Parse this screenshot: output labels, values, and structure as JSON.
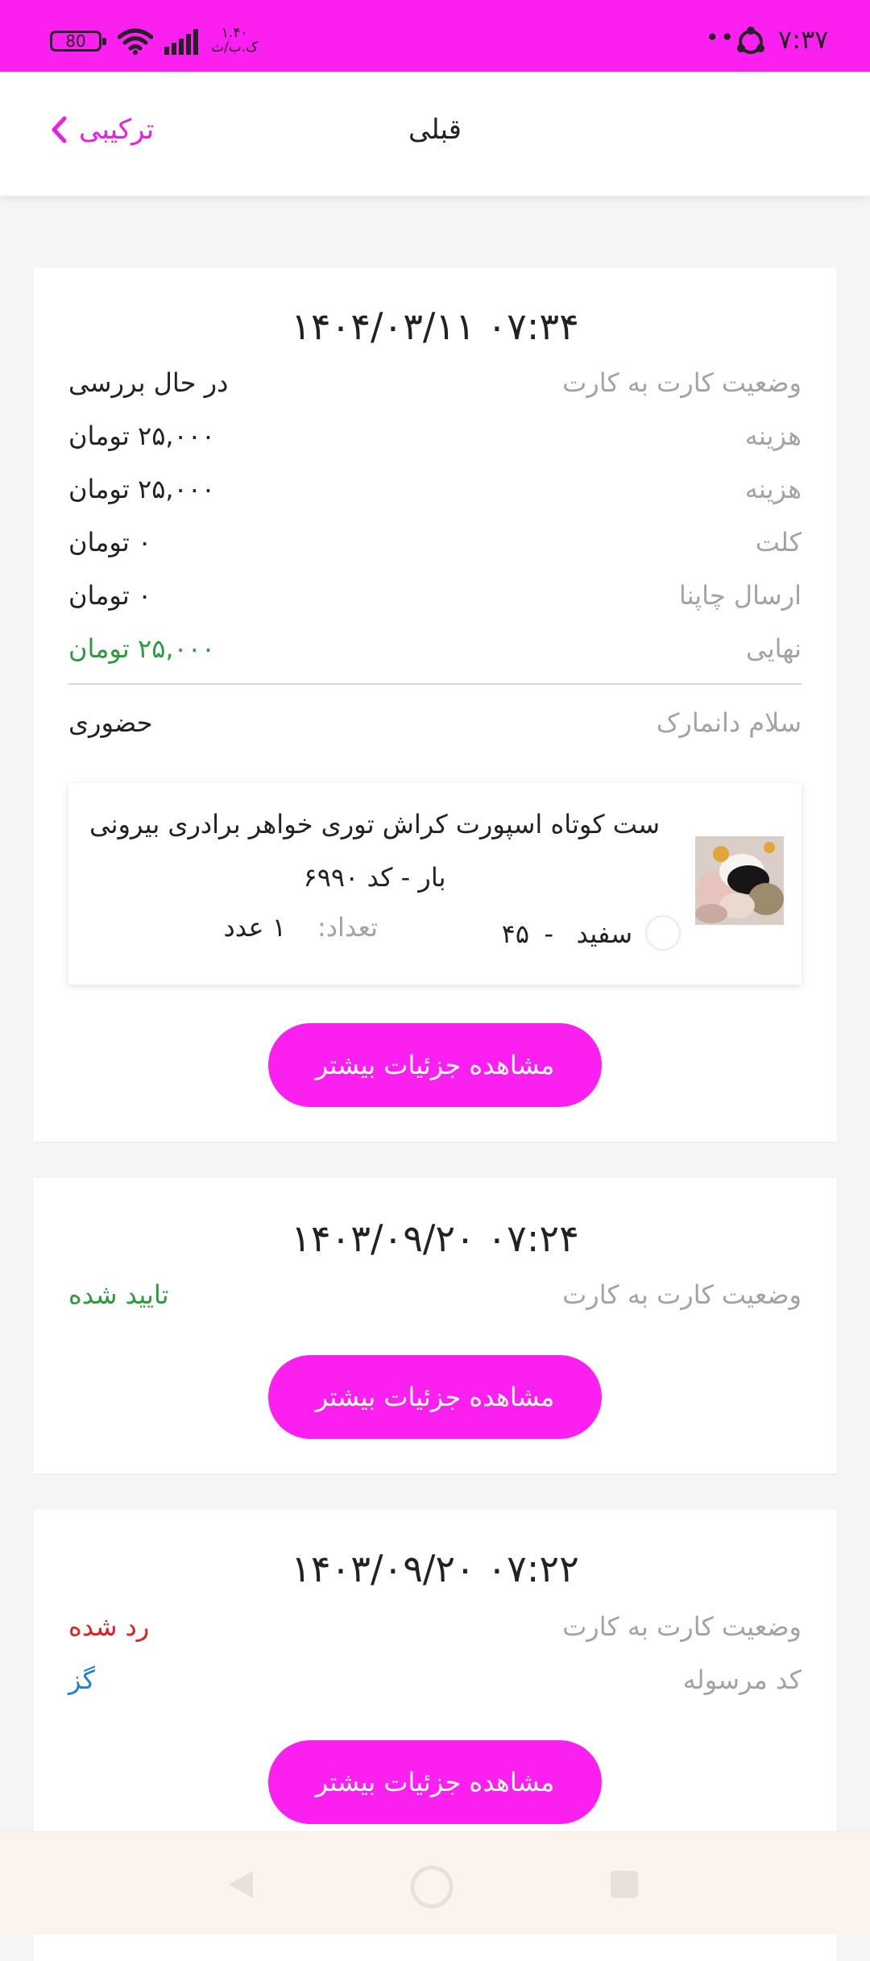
{
  "status_bar": {
    "time": "۷:۳۷",
    "dots": "••",
    "battery": "80",
    "speed_value": "۱.۴۰",
    "speed_unit": "ک.ب/ث"
  },
  "header": {
    "title": "قبلی",
    "back_label": "ترکیبی"
  },
  "cards": [
    {
      "date": "۱۴۰۴/۰۳/۱۱  ۰۷:۳۴",
      "rows": [
        {
          "label": "وضعیت کارت به کارت",
          "value": "در حال بررسی"
        },
        {
          "label": "هزینه",
          "value": "۲۵,۰۰۰ تومان"
        },
        {
          "label": "هزینه",
          "value": "۲۵,۰۰۰ تومان"
        },
        {
          "label": "کلت",
          "value": "۰ تومان"
        },
        {
          "label": "ارسال چاپنا",
          "value": "۰ تومان"
        },
        {
          "label": "نهایی",
          "value": "۲۵,۰۰۰ تومان"
        }
      ],
      "delivery": {
        "label": "سلام دانمارک",
        "value": "حضوری"
      },
      "item": {
        "title": "ست کوتاه اسپورت کراش توری خواهر برادری بیرونی بار - کد ۶۹۹۰",
        "color": "سفید",
        "size": "۴۵",
        "dash": "-",
        "qty_label": "تعداد:",
        "qty_value": "۱ عدد"
      },
      "button": "مشاهده جزئیات بیشتر"
    },
    {
      "date": "۱۴۰۳/۰۹/۲۰  ۰۷:۲۴",
      "rows": [
        {
          "label": "وضعیت کارت به کارت",
          "value": "تایید شده"
        }
      ],
      "button": "مشاهده جزئیات بیشتر"
    },
    {
      "date": "۱۴۰۳/۰۹/۲۰  ۰۷:۲۲",
      "rows": [
        {
          "label": "وضعیت کارت به کارت",
          "value": "رد شده"
        },
        {
          "label": "کد مرسوله",
          "value": "گز"
        }
      ],
      "button": "مشاهده جزئیات بیشتر"
    }
  ],
  "colors": {
    "accent": "#fb1ff0",
    "success": "#2e9a3e",
    "error": "#e02020",
    "link": "#1f7fd6"
  },
  "icons": {
    "back": "chevron-left-icon",
    "wifi": "wifi-icon",
    "signal": "signal-icon",
    "battery": "battery-icon",
    "sync": "sync-icon",
    "nav_back": "triangle-back-icon",
    "nav_home": "circle-home-icon",
    "nav_recents": "square-recents-icon"
  }
}
